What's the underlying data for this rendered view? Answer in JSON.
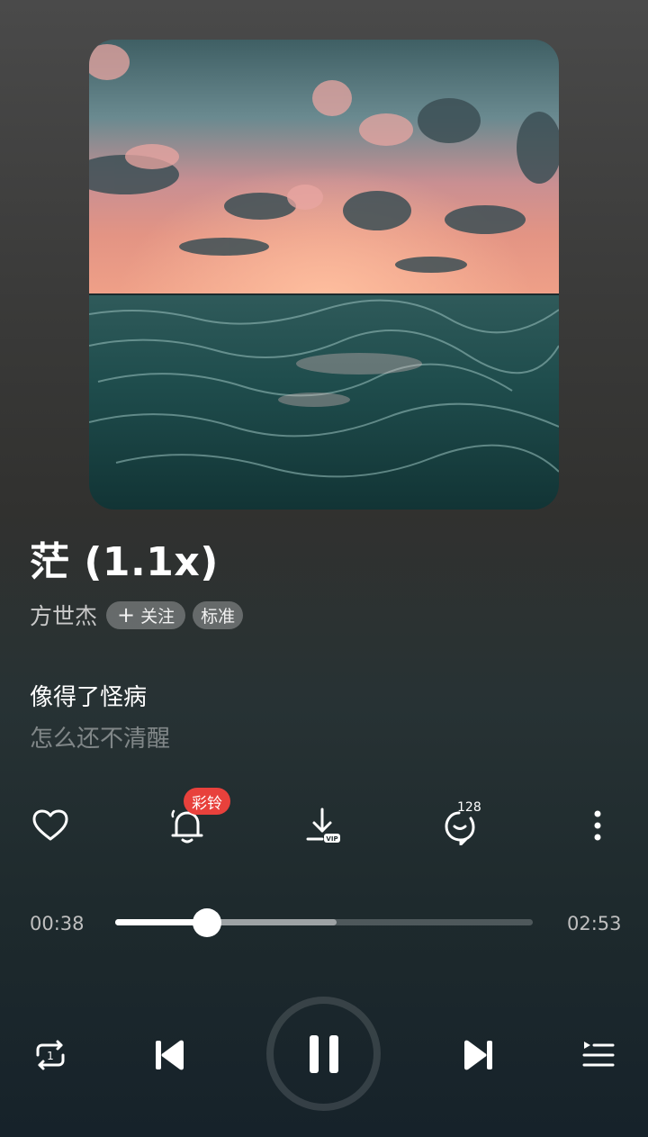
{
  "song": {
    "title": "茫 (1.1x)",
    "artist": "方世杰",
    "follow_label": "关注",
    "quality_label": "标准"
  },
  "lyrics": {
    "current": "像得了怪病",
    "next": "怎么还不清醒"
  },
  "actions": {
    "ringtone_badge": "彩铃",
    "comment_count": "128"
  },
  "progress": {
    "elapsed": "00:38",
    "duration": "02:53",
    "played_fraction": 0.22,
    "buffered_fraction": 0.53
  },
  "playback": {
    "state": "playing",
    "repeat_mode": "repeat-one"
  },
  "colors": {
    "accent_badge": "#e8413c"
  }
}
